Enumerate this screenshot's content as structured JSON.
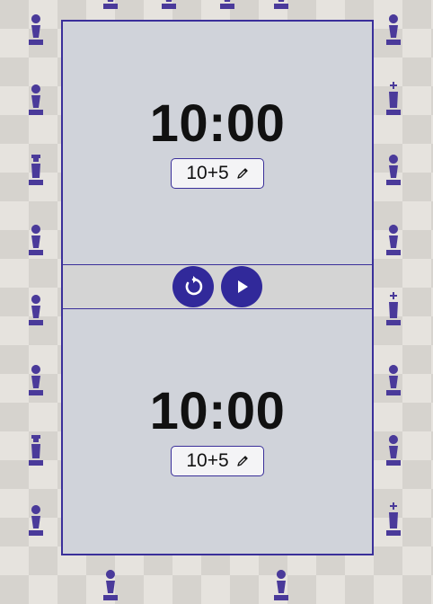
{
  "colors": {
    "accent": "#31299a",
    "border": "#3a2f9a",
    "panel": "#d0d3da",
    "bar": "#d4d4d4",
    "piece": "#4a3a9a"
  },
  "player_top": {
    "time": "10:00",
    "control": "10+5",
    "control_icon": "pencil-icon"
  },
  "controls": {
    "reset_icon": "reset-icon",
    "play_icon": "play-icon"
  },
  "player_bottom": {
    "time": "10:00",
    "control": "10+5",
    "control_icon": "pencil-icon"
  }
}
